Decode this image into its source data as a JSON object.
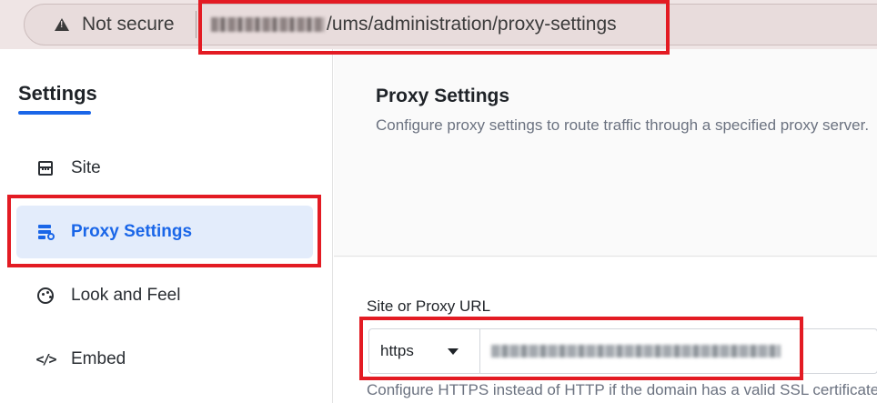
{
  "browser": {
    "security_label": "Not secure",
    "security_icon": "warning-icon",
    "url_path": "/ums/administration/proxy-settings"
  },
  "sidebar": {
    "title": "Settings",
    "accent_color": "#1a66e8",
    "items": [
      {
        "label": "Site",
        "icon": "site-icon",
        "active": false
      },
      {
        "label": "Proxy Settings",
        "icon": "proxy-icon",
        "active": true
      },
      {
        "label": "Look and Feel",
        "icon": "palette-icon",
        "active": false
      },
      {
        "label": "Embed",
        "icon": "code-icon",
        "active": false
      }
    ]
  },
  "main": {
    "title": "Proxy Settings",
    "description": "Configure proxy settings to route traffic through a specified proxy server.",
    "form": {
      "field_label": "Site or Proxy URL",
      "protocol_value": "https",
      "helper_text": "Configure HTTPS instead of HTTP if the domain has a valid SSL certificate."
    }
  },
  "annotations": {
    "highlight_color": "#e31b23"
  }
}
